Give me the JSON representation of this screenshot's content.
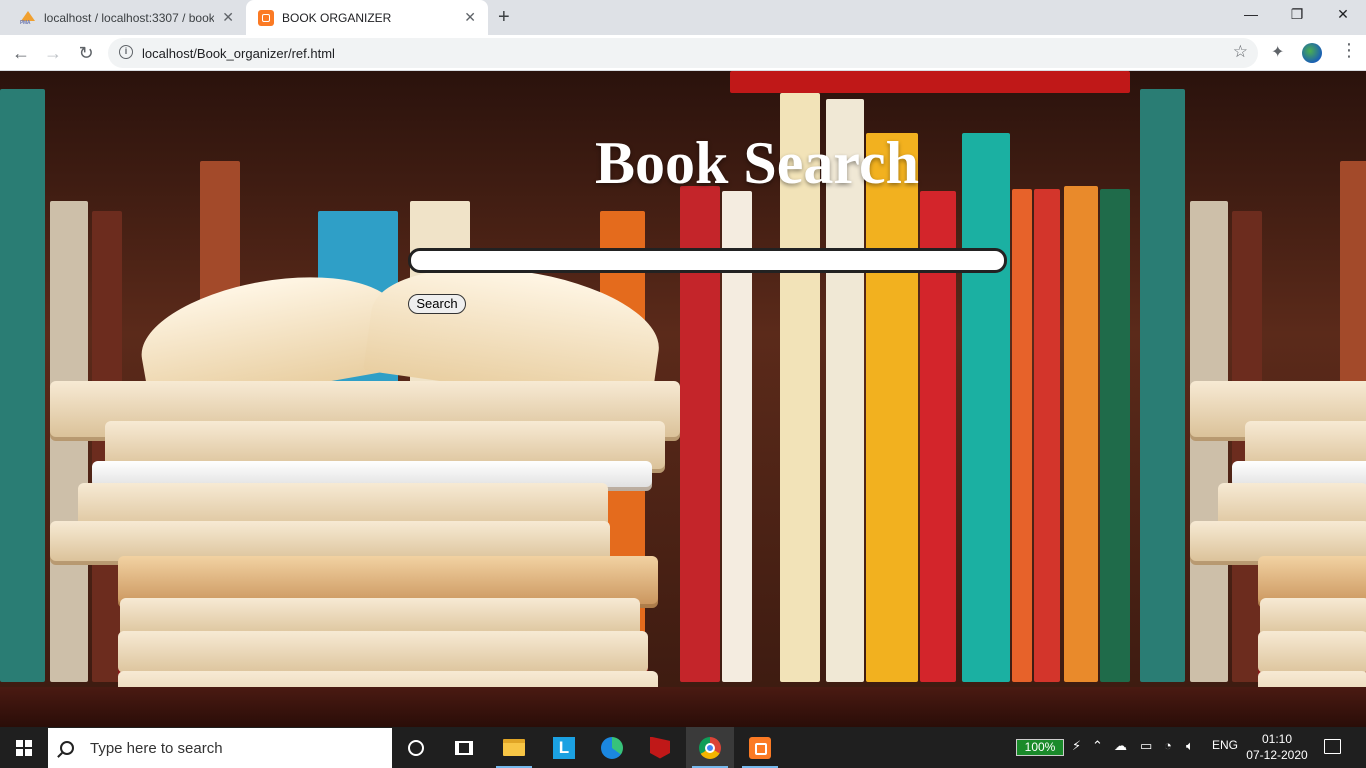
{
  "browser": {
    "tabs": [
      {
        "title": "localhost / localhost:3307 / book_",
        "active": false,
        "icon": "phpmyadmin-icon"
      },
      {
        "title": "BOOK ORGANIZER",
        "active": true,
        "icon": "xampp-icon"
      }
    ],
    "new_tab": "+",
    "controls": {
      "minimize": "—",
      "restore": "❐",
      "close": "✕"
    },
    "nav": {
      "back": "←",
      "forward": "→",
      "reload": "↻"
    },
    "url": "localhost/Book_organizer/ref.html",
    "star": "☆",
    "extensions": "✦",
    "menu": "⋮",
    "tab_close": "✕"
  },
  "page": {
    "heading": "Book Search",
    "search": {
      "value": "",
      "placeholder": ""
    },
    "button_label": "Search"
  },
  "taskbar": {
    "search_placeholder": "Type here to search",
    "apps": [
      "cortana",
      "task-view",
      "file-explorer",
      "lenovo-app",
      "edge",
      "mcafee",
      "chrome",
      "xampp"
    ],
    "battery": "100%",
    "language": "ENG",
    "time": "01:10",
    "date": "07-12-2020"
  },
  "colors": {
    "accent": "#fb7a24",
    "heading": "#ffffff",
    "taskbar": "#1f1f1f"
  }
}
